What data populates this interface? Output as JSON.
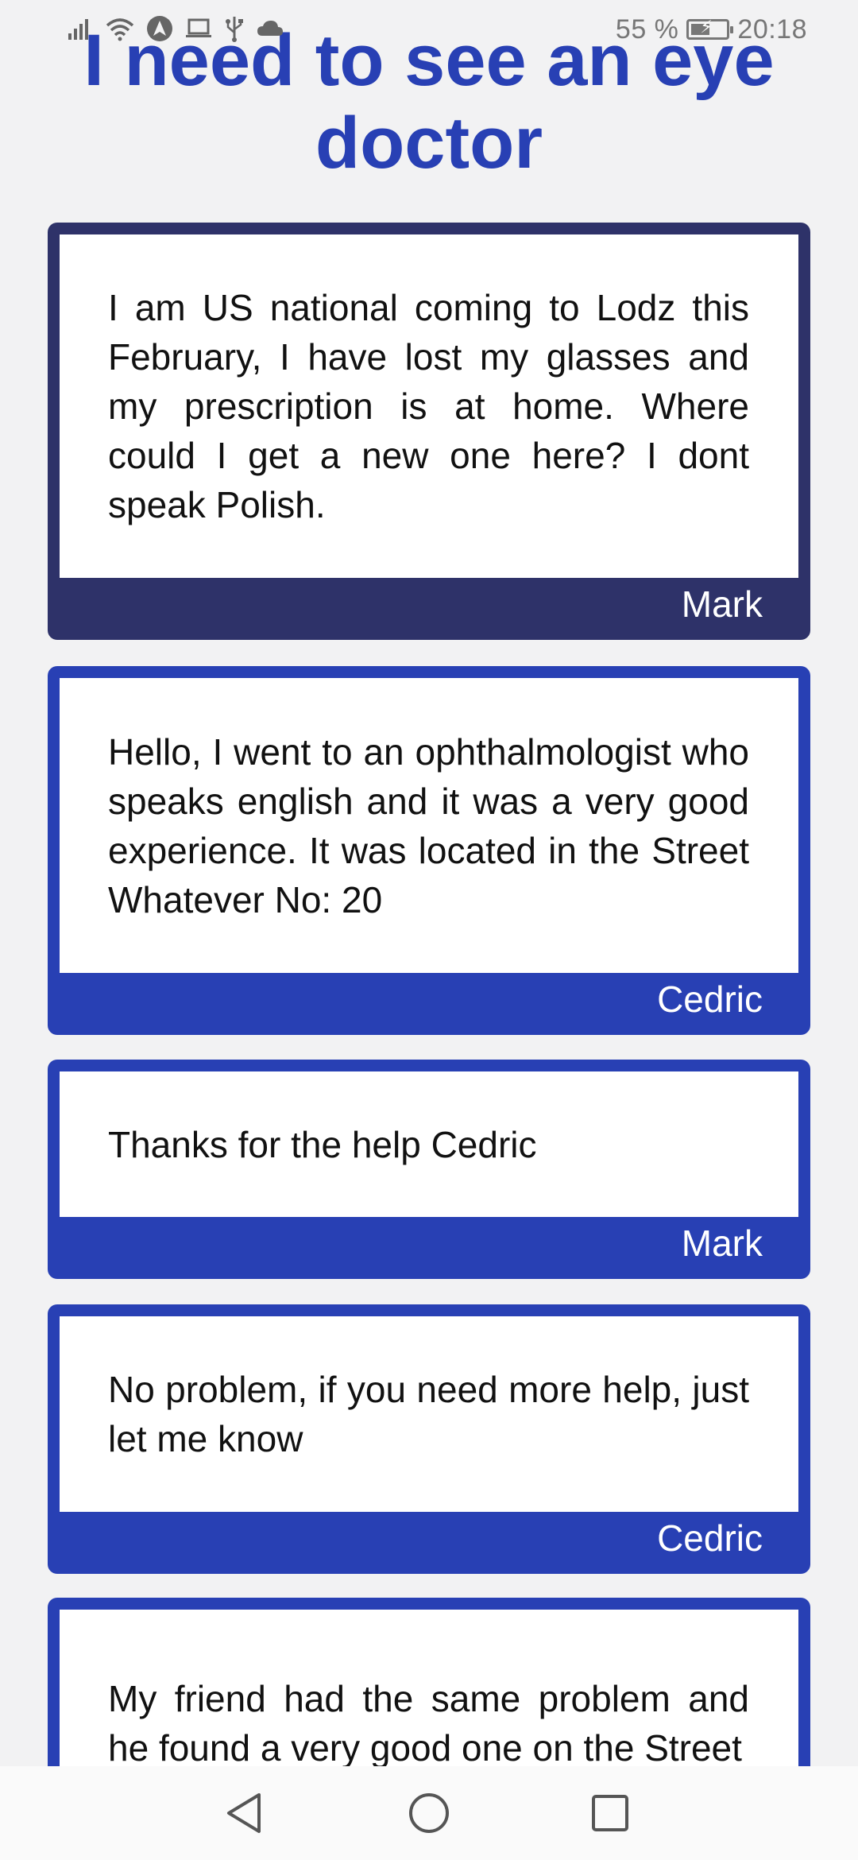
{
  "status_bar": {
    "battery_text": "55 %",
    "battery_level": 0.55,
    "time": "20:18",
    "icons": [
      "signal-icon",
      "wifi-icon",
      "navigation-app-icon",
      "laptop-icon",
      "usb-icon",
      "cloud-icon",
      "battery-icon"
    ]
  },
  "page": {
    "title": "I need to see an eye doctor"
  },
  "colors": {
    "primary": "#2840b4",
    "first_card": "#2e3269",
    "background": "#f2f2f3"
  },
  "posts": [
    {
      "text": "I am US national coming to Lodz this February, I have lost my glasses and my prescription is at home. Where could I get a new one here? I dont speak Polish.",
      "author": "Mark"
    },
    {
      "text": "Hello, I went to an ophthalmologist who speaks english and it was a very good experience. It was located in the Street Whatever No: 20",
      "author": "Cedric"
    },
    {
      "text": "Thanks for the help Cedric",
      "author": "Mark"
    },
    {
      "text": "No problem, if you need more help, just let me know",
      "author": "Cedric"
    },
    {
      "text": "My friend had the same problem and he found a very good one on the Street",
      "author": ""
    }
  ],
  "nav": {
    "icons": [
      "back-icon",
      "home-icon",
      "recents-icon"
    ]
  }
}
